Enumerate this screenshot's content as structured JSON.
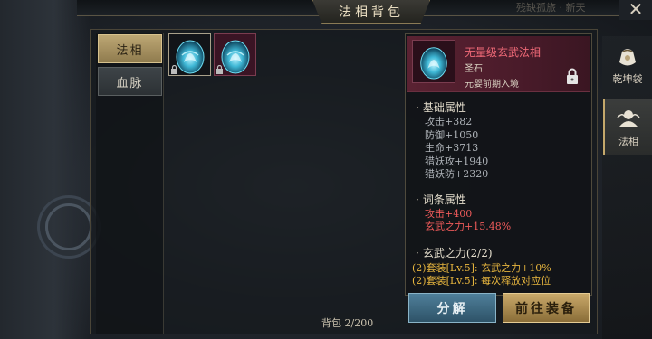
{
  "window": {
    "title": "法相背包",
    "close_icon": "close-icon",
    "top_ghost_text": "残缺孤旅 · 新天"
  },
  "tabs": [
    {
      "label": "法相",
      "active": true
    },
    {
      "label": "血脉",
      "active": false
    }
  ],
  "slots": [
    {
      "icon": "blue-egg-icon",
      "locked": true,
      "rarity_color": "#1a1d22"
    },
    {
      "icon": "blue-egg-icon",
      "locked": true,
      "rarity_color": "#3a1424"
    }
  ],
  "bag": {
    "label": "背包 2/200",
    "used": 2,
    "capacity": 200
  },
  "detail": {
    "name": "无量级玄武法相",
    "type": "圣石",
    "requirement": "元婴前期入境",
    "name_color": "#f06a78",
    "sections": {
      "base": {
        "title": "基础属性",
        "attrs": [
          "攻击+382",
          "防御+1050",
          "生命+3713",
          "猎妖攻+1940",
          "猎妖防+2320"
        ]
      },
      "affix": {
        "title": "词条属性",
        "attrs": [
          "攻击+400",
          "玄武之力+15.48%"
        ]
      },
      "set": {
        "title": "玄武之力(2/2)",
        "attrs": [
          "(2)套装[Lv.5]: 玄武之力+10%",
          "(2)套装[Lv.5]: 每次释放对应位"
        ]
      }
    }
  },
  "buttons": {
    "decompose": "分解",
    "equip": "前往装备"
  },
  "side_nav": [
    {
      "label": "乾坤袋",
      "icon": "pouch-icon",
      "active": false
    },
    {
      "label": "法相",
      "icon": "dharma-icon",
      "active": true
    }
  ],
  "colors": {
    "accent_gold": "#c4a86b",
    "attr_red": "#ee5a5a",
    "set_gold": "#e8b63e",
    "decompose_blue": "#4f7f9a"
  }
}
